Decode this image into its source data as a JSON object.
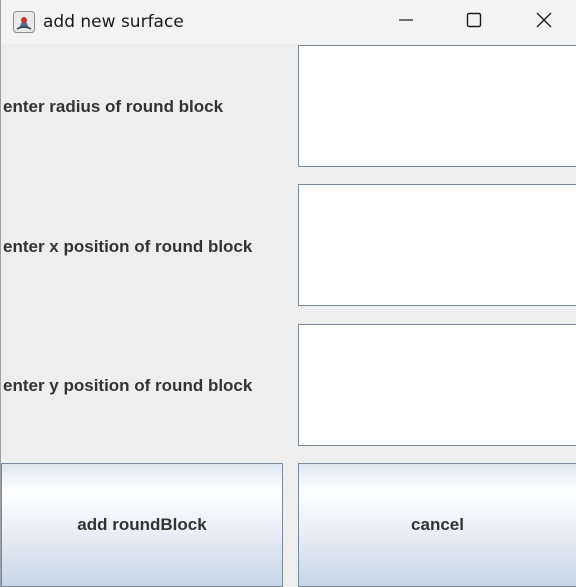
{
  "window": {
    "title": "add new surface",
    "icons": {
      "app": "java-app-icon",
      "minimize": "minimize-icon",
      "maximize": "maximize-icon",
      "close": "close-icon"
    }
  },
  "form": {
    "fields": [
      {
        "label": "enter radius of round block",
        "value": ""
      },
      {
        "label": "enter x position of round block",
        "value": ""
      },
      {
        "label": "enter y position of round block",
        "value": ""
      }
    ]
  },
  "buttons": {
    "add_label": "add roundBlock",
    "cancel_label": "cancel"
  }
}
